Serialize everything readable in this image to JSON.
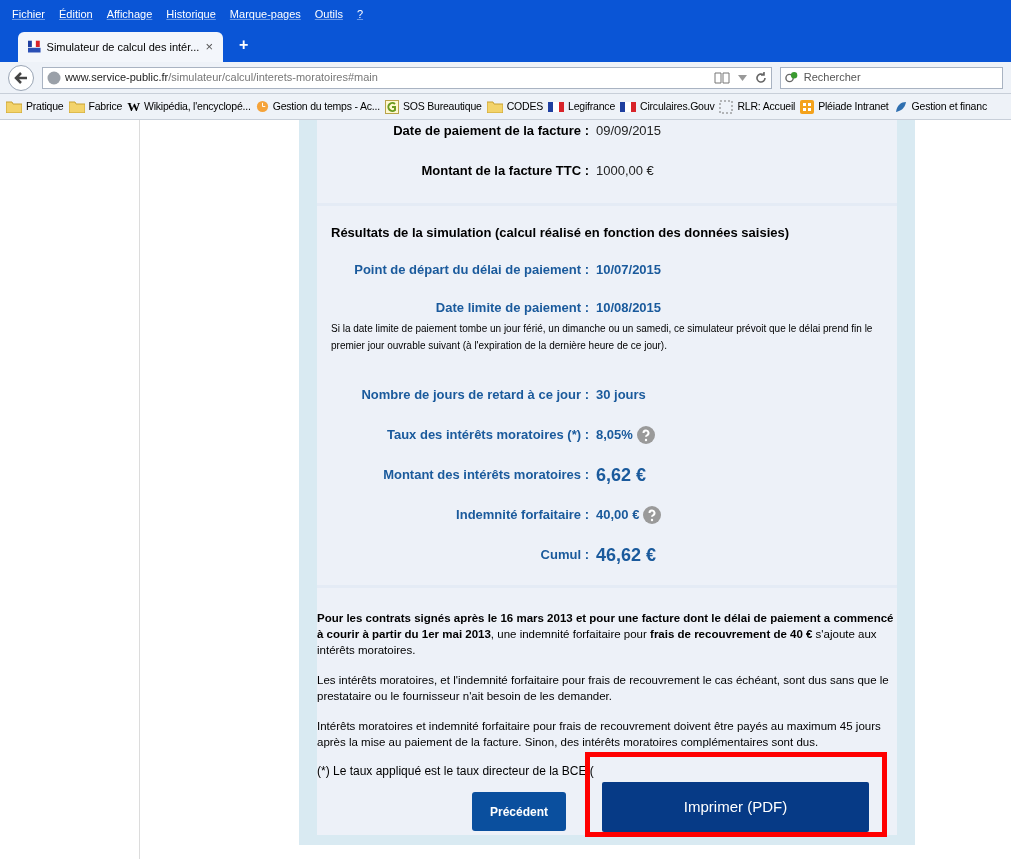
{
  "menu_bar": [
    "Fichier",
    "Édition",
    "Affichage",
    "Historique",
    "Marque-pages",
    "Outils",
    "?"
  ],
  "tab": {
    "title": "Simulateur de calcul des intér...",
    "close": "×",
    "new_tab": "+"
  },
  "address_bar": {
    "domain": "www.service-public.fr",
    "path": "/simulateur/calcul/interets-moratoires#main"
  },
  "search": {
    "placeholder": "Rechercher"
  },
  "bookmarks": [
    {
      "label": "Pratique",
      "kind": "folder"
    },
    {
      "label": "Fabrice",
      "kind": "folder"
    },
    {
      "label": "Wikipédia, l'encyclopé...",
      "kind": "wiki",
      "icon_text": "W"
    },
    {
      "label": "Gestion du temps - Ac...",
      "kind": "clock"
    },
    {
      "label": "SOS Bureautique",
      "kind": "g"
    },
    {
      "label": "CODES",
      "kind": "folder"
    },
    {
      "label": "Legifrance",
      "kind": "flag"
    },
    {
      "label": "Circulaires.Gouv",
      "kind": "flag"
    },
    {
      "label": "RLR: Accueil",
      "kind": "dashed"
    },
    {
      "label": "Pléiade Intranet",
      "kind": "grid"
    },
    {
      "label": "Gestion et financ",
      "kind": "sp"
    }
  ],
  "inputs": [
    {
      "label": "Date de paiement de la facture :",
      "value": "09/09/2015"
    },
    {
      "label": "Montant de la facture TTC :",
      "value": "1000,00 €"
    }
  ],
  "results": {
    "title": "Résultats de la simulation (calcul réalisé en fonction des données saisies)",
    "rows_top": [
      {
        "label": "Point de départ du délai de paiement :",
        "value": "10/07/2015",
        "emphasis": false,
        "help": false
      },
      {
        "label": "Date limite de paiement :",
        "value": "10/08/2015",
        "emphasis": false,
        "help": false
      }
    ],
    "note": "Si la date limite de paiement tombe un jour férié, un dimanche ou un samedi, ce simulateur prévoit que le délai prend fin le premier jour ouvrable suivant (à l'expiration de la dernière heure de ce jour).",
    "rows": [
      {
        "label": "Nombre de jours de retard à ce jour :",
        "value": "30 jours",
        "emphasis": false,
        "help": false
      },
      {
        "label": "Taux des intérêts moratoires (*) :",
        "value": "8,05%",
        "emphasis": false,
        "help": true
      },
      {
        "label": "Montant des intérêts moratoires :",
        "value": "6,62 €",
        "emphasis": true,
        "help": false
      },
      {
        "label": "Indemnité forfaitaire :",
        "value": "40,00 €",
        "emphasis": false,
        "help": true
      },
      {
        "label": "Cumul :",
        "value": "46,62 €",
        "emphasis": true,
        "help": false
      }
    ]
  },
  "paragraphs": [
    "**Pour les contrats signés après le 16 mars 2013 et pour une facture dont le délai de paiement a commencé à courir à partir du 1er mai 2013**, une indemnité forfaitaire pour **frais de recouvrement de 40 €** s'ajoute aux intérêts moratoires.",
    "Les intérêts moratoires, et l'indemnité forfaitaire pour frais de recouvrement le cas échéant, sont dus sans que le prestataire ou le fournisseur n'ait besoin de les demander.",
    "Intérêts moratoires et indemnité forfaitaire pour frais de recouvrement doivent être payés au maximum 45 jours après la mise au paiement de la facture. Sinon, des intérêts moratoires complémentaires sont dus."
  ],
  "footnote": "(*) Le taux appliqué est le taux directeur de la BCE (",
  "buttons": {
    "previous": "Précédent",
    "print": "Imprimer (PDF)"
  },
  "highlight": {
    "on": true
  }
}
